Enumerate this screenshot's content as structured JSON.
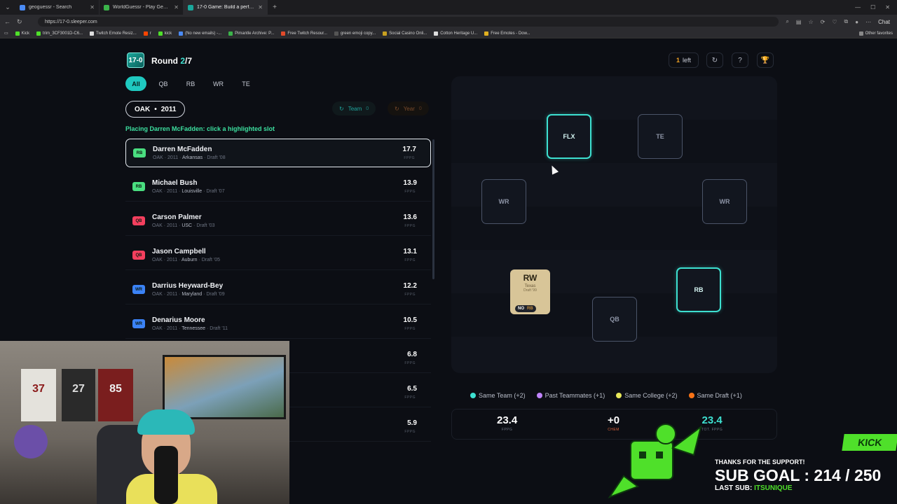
{
  "browser": {
    "tabs": [
      {
        "title": "geoguessr - Search",
        "color": "#4a8af4"
      },
      {
        "title": "WorldGuessr - Play Geoguessr for free",
        "color": "#3bb34a"
      },
      {
        "title": "17-0 Game: Build a perfect Fantasy",
        "color": "#1aa79b"
      }
    ],
    "url": "https://17-0.sleeper.com",
    "bookmarks": [
      {
        "label": "Kick",
        "color": "#4fe02a"
      },
      {
        "label": "trim_3CF3001D-C6...",
        "color": "#4fe02a"
      },
      {
        "label": "Twitch Emote Resiz...",
        "color": "#ddd"
      },
      {
        "label": "r",
        "color": "#ff4500"
      },
      {
        "label": "kick",
        "color": "#4fe02a"
      },
      {
        "label": "(No new emails) -...",
        "color": "#4a8af4"
      },
      {
        "label": "Pimantle Archive: P...",
        "color": "#3bb34a"
      },
      {
        "label": "Free Twitch Resour...",
        "color": "#e04a2a"
      },
      {
        "label": "green emoji copy...",
        "color": "#555"
      },
      {
        "label": "Social Casino Onli...",
        "color": "#c8a020"
      },
      {
        "label": "Cotton Heritage U...",
        "color": "#ddd"
      },
      {
        "label": "Free Emotes - Dow...",
        "color": "#e0b020"
      }
    ],
    "other_bookmarks": "Other favorites",
    "chat_label": "Chat"
  },
  "app": {
    "logo": "17-0",
    "round_label": "Round",
    "round_current": "2",
    "round_total": "/7",
    "filters": [
      "All",
      "QB",
      "RB",
      "WR",
      "TE"
    ],
    "team_chip": {
      "team": "OAK",
      "sep": "•",
      "year": "2011"
    },
    "team_pill": {
      "label": "Team",
      "count": "0"
    },
    "year_pill": {
      "label": "Year",
      "count": "0"
    },
    "placing_text": "Placing Darren McFadden: click a highlighted slot",
    "left_count": "1",
    "left_label": "left",
    "players": [
      {
        "pos": "RB",
        "name": "Darren McFadden",
        "team": "OAK",
        "year": "2011",
        "college": "Arkansas",
        "draft": "Draft '08",
        "score": "17.7",
        "fppg": "FPPG",
        "color": "#4ade80"
      },
      {
        "pos": "RB",
        "name": "Michael Bush",
        "team": "OAK",
        "year": "2011",
        "college": "Louisville",
        "draft": "Draft '07",
        "score": "13.9",
        "fppg": "FPPG",
        "color": "#4ade80"
      },
      {
        "pos": "QB",
        "name": "Carson Palmer",
        "team": "OAK",
        "year": "2011",
        "college": "USC",
        "draft": "Draft '03",
        "score": "13.6",
        "fppg": "FPPG",
        "color": "#f43f5e"
      },
      {
        "pos": "QB",
        "name": "Jason Campbell",
        "team": "OAK",
        "year": "2011",
        "college": "Auburn",
        "draft": "Draft '05",
        "score": "13.1",
        "fppg": "FPPG",
        "color": "#f43f5e"
      },
      {
        "pos": "WR",
        "name": "Darrius Heyward-Bey",
        "team": "OAK",
        "year": "2011",
        "college": "Maryland",
        "draft": "Draft '09",
        "score": "12.2",
        "fppg": "FPPG",
        "color": "#3b82f6"
      },
      {
        "pos": "WR",
        "name": "Denarius Moore",
        "team": "OAK",
        "year": "2011",
        "college": "Tennessee",
        "draft": "Draft '11",
        "score": "10.5",
        "fppg": "FPPG",
        "color": "#3b82f6"
      },
      {
        "pos": "",
        "name": "",
        "team": "",
        "year": "",
        "college": "",
        "draft": "",
        "score": "6.8",
        "fppg": "FPPG",
        "color": "#3b82f6"
      },
      {
        "pos": "",
        "name": "",
        "team": "",
        "year": "",
        "college": "",
        "draft": "",
        "score": "6.5",
        "fppg": "FPPG",
        "color": "#3b82f6"
      },
      {
        "pos": "",
        "name": "",
        "team": "",
        "year": "",
        "college": "",
        "draft": "",
        "score": "5.9",
        "fppg": "FPPG",
        "color": "#3b82f6"
      }
    ],
    "slots": {
      "flx": "FLX",
      "te": "TE",
      "wr1": "WR",
      "wr2": "WR",
      "rb": "RB",
      "qb": "QB"
    },
    "placed_card": {
      "pos": "RW",
      "college": "Texas",
      "draft": "Draft '99",
      "tag_no": "NO",
      "tag_pos": "RB"
    },
    "legend": [
      {
        "label": "Same Team (+2)",
        "color": "#3de0d0"
      },
      {
        "label": "Past Teammates (+1)",
        "color": "#c084fc"
      },
      {
        "label": "Same College (+2)",
        "color": "#e8e85a"
      },
      {
        "label": "Same Draft (+1)",
        "color": "#f97316"
      }
    ],
    "stats": {
      "fppg": {
        "value": "23.4",
        "label": "FPPG"
      },
      "chem": {
        "value": "+0",
        "label": "CHEM"
      },
      "total": {
        "value": "23.4",
        "label": "TOT. FPPG"
      }
    }
  },
  "overlay": {
    "kick": "KICK",
    "thanks": "THANKS FOR THE SUPPORT!",
    "sub_goal": "SUB GOAL : 214 / 250",
    "last_sub_label": "LAST SUB:",
    "last_sub_name": "ITSUNIQUE",
    "jerseys": [
      "37",
      "27",
      "85"
    ]
  }
}
